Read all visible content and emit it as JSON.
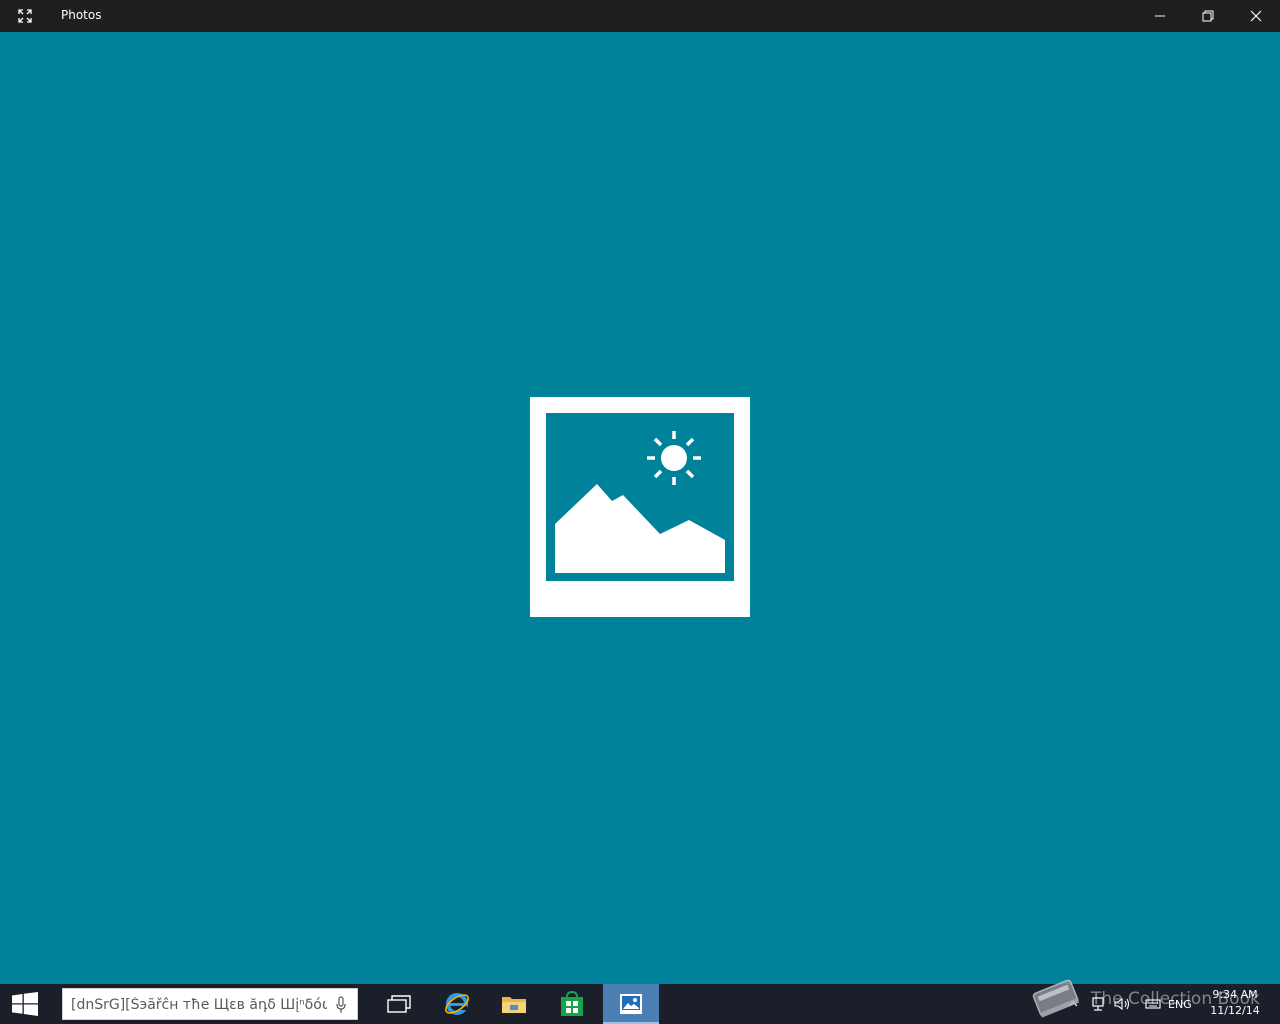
{
  "window": {
    "title": "Photos",
    "controls": [
      "minimize",
      "restore",
      "close"
    ]
  },
  "splash": {
    "background": "#00839a",
    "icon": "photo-landscape-icon"
  },
  "taskbar": {
    "search_text": "[dnSrG][Šэãřĉн тħе Щεв ăդδ Шįⁿδόώŝ",
    "apps": [
      {
        "name": "task-view",
        "icon": "task-view-icon"
      },
      {
        "name": "internet-explorer",
        "icon": "ie-icon"
      },
      {
        "name": "file-explorer",
        "icon": "folder-icon"
      },
      {
        "name": "store",
        "icon": "store-icon"
      },
      {
        "name": "photos",
        "icon": "photos-icon",
        "active": true
      }
    ],
    "tray": {
      "language": "ENG",
      "time": "9:34 AM",
      "date": "11/12/14"
    }
  },
  "watermark": {
    "text": "The Collection Book"
  }
}
